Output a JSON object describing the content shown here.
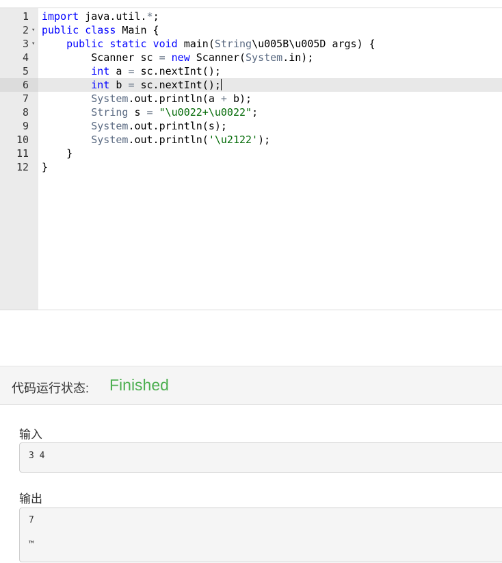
{
  "editor": {
    "active_line": 6,
    "lines": [
      {
        "num": "1",
        "fold": "",
        "tokens": [
          {
            "t": "import",
            "c": "kw"
          },
          {
            "t": " java.util.",
            "c": "plain"
          },
          {
            "t": "*",
            "c": "op"
          },
          {
            "t": ";",
            "c": "plain"
          }
        ]
      },
      {
        "num": "2",
        "fold": "▾",
        "tokens": [
          {
            "t": "public",
            "c": "kw"
          },
          {
            "t": " ",
            "c": "plain"
          },
          {
            "t": "class",
            "c": "kw"
          },
          {
            "t": " Main {",
            "c": "plain"
          }
        ]
      },
      {
        "num": "3",
        "fold": "▾",
        "tokens": [
          {
            "t": "    ",
            "c": "plain"
          },
          {
            "t": "public",
            "c": "kw"
          },
          {
            "t": " ",
            "c": "plain"
          },
          {
            "t": "static",
            "c": "kw"
          },
          {
            "t": " ",
            "c": "plain"
          },
          {
            "t": "void",
            "c": "kw"
          },
          {
            "t": " main(",
            "c": "plain"
          },
          {
            "t": "String",
            "c": "sys"
          },
          {
            "t": "\\u005B\\u005D args) {",
            "c": "plain"
          }
        ]
      },
      {
        "num": "4",
        "fold": "",
        "tokens": [
          {
            "t": "        Scanner sc ",
            "c": "plain"
          },
          {
            "t": "=",
            "c": "op"
          },
          {
            "t": " ",
            "c": "plain"
          },
          {
            "t": "new",
            "c": "kw"
          },
          {
            "t": " Scanner(",
            "c": "plain"
          },
          {
            "t": "System",
            "c": "sys"
          },
          {
            "t": ".in);",
            "c": "plain"
          }
        ]
      },
      {
        "num": "5",
        "fold": "",
        "tokens": [
          {
            "t": "        ",
            "c": "plain"
          },
          {
            "t": "int",
            "c": "kw"
          },
          {
            "t": " a ",
            "c": "plain"
          },
          {
            "t": "=",
            "c": "op"
          },
          {
            "t": " sc.nextInt();",
            "c": "plain"
          }
        ]
      },
      {
        "num": "6",
        "fold": "",
        "tokens": [
          {
            "t": "        ",
            "c": "plain"
          },
          {
            "t": "int",
            "c": "kw"
          },
          {
            "t": " b ",
            "c": "plain"
          },
          {
            "t": "=",
            "c": "op"
          },
          {
            "t": " sc.nextInt();",
            "c": "plain"
          }
        ]
      },
      {
        "num": "7",
        "fold": "",
        "tokens": [
          {
            "t": "        ",
            "c": "plain"
          },
          {
            "t": "System",
            "c": "sys"
          },
          {
            "t": ".out.println(a ",
            "c": "plain"
          },
          {
            "t": "+",
            "c": "op"
          },
          {
            "t": " b);",
            "c": "plain"
          }
        ]
      },
      {
        "num": "8",
        "fold": "",
        "tokens": [
          {
            "t": "        ",
            "c": "plain"
          },
          {
            "t": "String",
            "c": "sys"
          },
          {
            "t": " s ",
            "c": "plain"
          },
          {
            "t": "=",
            "c": "op"
          },
          {
            "t": " ",
            "c": "plain"
          },
          {
            "t": "\"\\u0022+\\u0022\"",
            "c": "str"
          },
          {
            "t": ";",
            "c": "plain"
          }
        ]
      },
      {
        "num": "9",
        "fold": "",
        "tokens": [
          {
            "t": "        ",
            "c": "plain"
          },
          {
            "t": "System",
            "c": "sys"
          },
          {
            "t": ".out.println(s);",
            "c": "plain"
          }
        ]
      },
      {
        "num": "10",
        "fold": "",
        "tokens": [
          {
            "t": "        ",
            "c": "plain"
          },
          {
            "t": "System",
            "c": "sys"
          },
          {
            "t": ".out.println(",
            "c": "plain"
          },
          {
            "t": "'\\u2122'",
            "c": "str"
          },
          {
            "t": ");",
            "c": "plain"
          }
        ]
      },
      {
        "num": "11",
        "fold": "",
        "tokens": [
          {
            "t": "    }",
            "c": "plain"
          }
        ]
      },
      {
        "num": "12",
        "fold": "",
        "tokens": [
          {
            "t": "}",
            "c": "plain"
          }
        ]
      }
    ]
  },
  "status": {
    "label": "代码运行状态:",
    "value": "Finished",
    "value_color": "#4caf50"
  },
  "input": {
    "label": "输入",
    "lines": [
      "3 4"
    ]
  },
  "output": {
    "label": "输出",
    "lines": [
      "7",
      "",
      "™"
    ]
  },
  "colors": {
    "keyword": "#0000ff",
    "string": "#036a07",
    "builtin": "#5a6a82",
    "gutter": "#ebebeb",
    "active_line": "#e8e8e8"
  }
}
